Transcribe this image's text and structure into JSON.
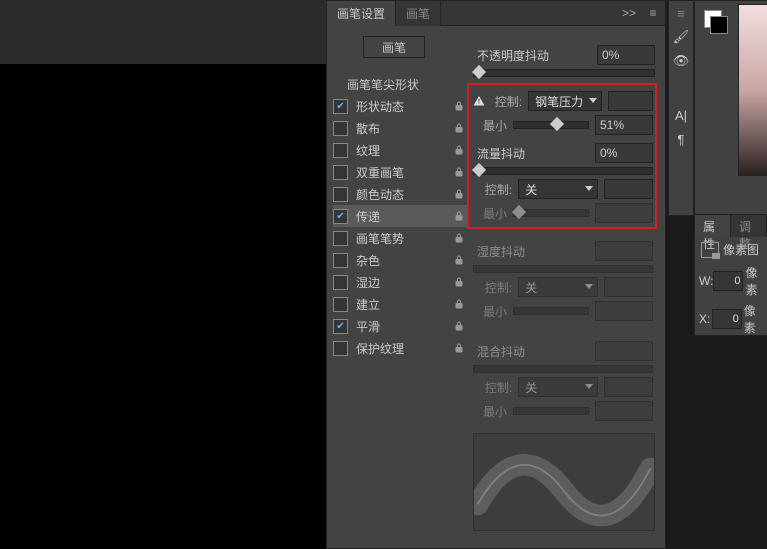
{
  "tabs": {
    "active": "画笔设置",
    "inactive": "画笔"
  },
  "expand_glyph": ">>",
  "menu_glyph": "≡",
  "brush_button": "画笔",
  "tip_shape": "画笔笔尖形状",
  "options": [
    {
      "label": "形状动态",
      "checked": true
    },
    {
      "label": "散布",
      "checked": false
    },
    {
      "label": "纹理",
      "checked": false
    },
    {
      "label": "双重画笔",
      "checked": false
    },
    {
      "label": "颜色动态",
      "checked": false
    },
    {
      "label": "传递",
      "checked": true
    },
    {
      "label": "画笔笔势",
      "checked": false
    },
    {
      "label": "杂色",
      "checked": false
    },
    {
      "label": "湿边",
      "checked": false
    },
    {
      "label": "建立",
      "checked": false
    },
    {
      "label": "平滑",
      "checked": true
    },
    {
      "label": "保护纹理",
      "checked": false
    }
  ],
  "opacity_jitter": {
    "label": "不透明度抖动",
    "value": "0%",
    "slider_pos": 0
  },
  "control_label": "控制:",
  "min_label": "最小",
  "box1": {
    "control_value": "钢笔压力",
    "min_value": "51%",
    "min_slider_pos": 51,
    "flow_label": "流量抖动",
    "flow_value": "0%",
    "control2_value": "关",
    "min2_value": ""
  },
  "wet_block": {
    "label": "湿度抖动",
    "value": "",
    "control": "关",
    "min": ""
  },
  "mix_block": {
    "label": "混合抖动",
    "value": "",
    "control": "关",
    "min": ""
  },
  "side_glyphs": {
    "brush": "🖌",
    "eye": "👁",
    "A": "A|",
    "para": "¶"
  },
  "properties": {
    "tab_active": "属性",
    "tab_inactive": "调整",
    "pixel_label": "像素图",
    "W": {
      "key": "W:",
      "val": "0",
      "unit": "像素"
    },
    "X": {
      "key": "X:",
      "val": "0",
      "unit": "像素"
    }
  }
}
